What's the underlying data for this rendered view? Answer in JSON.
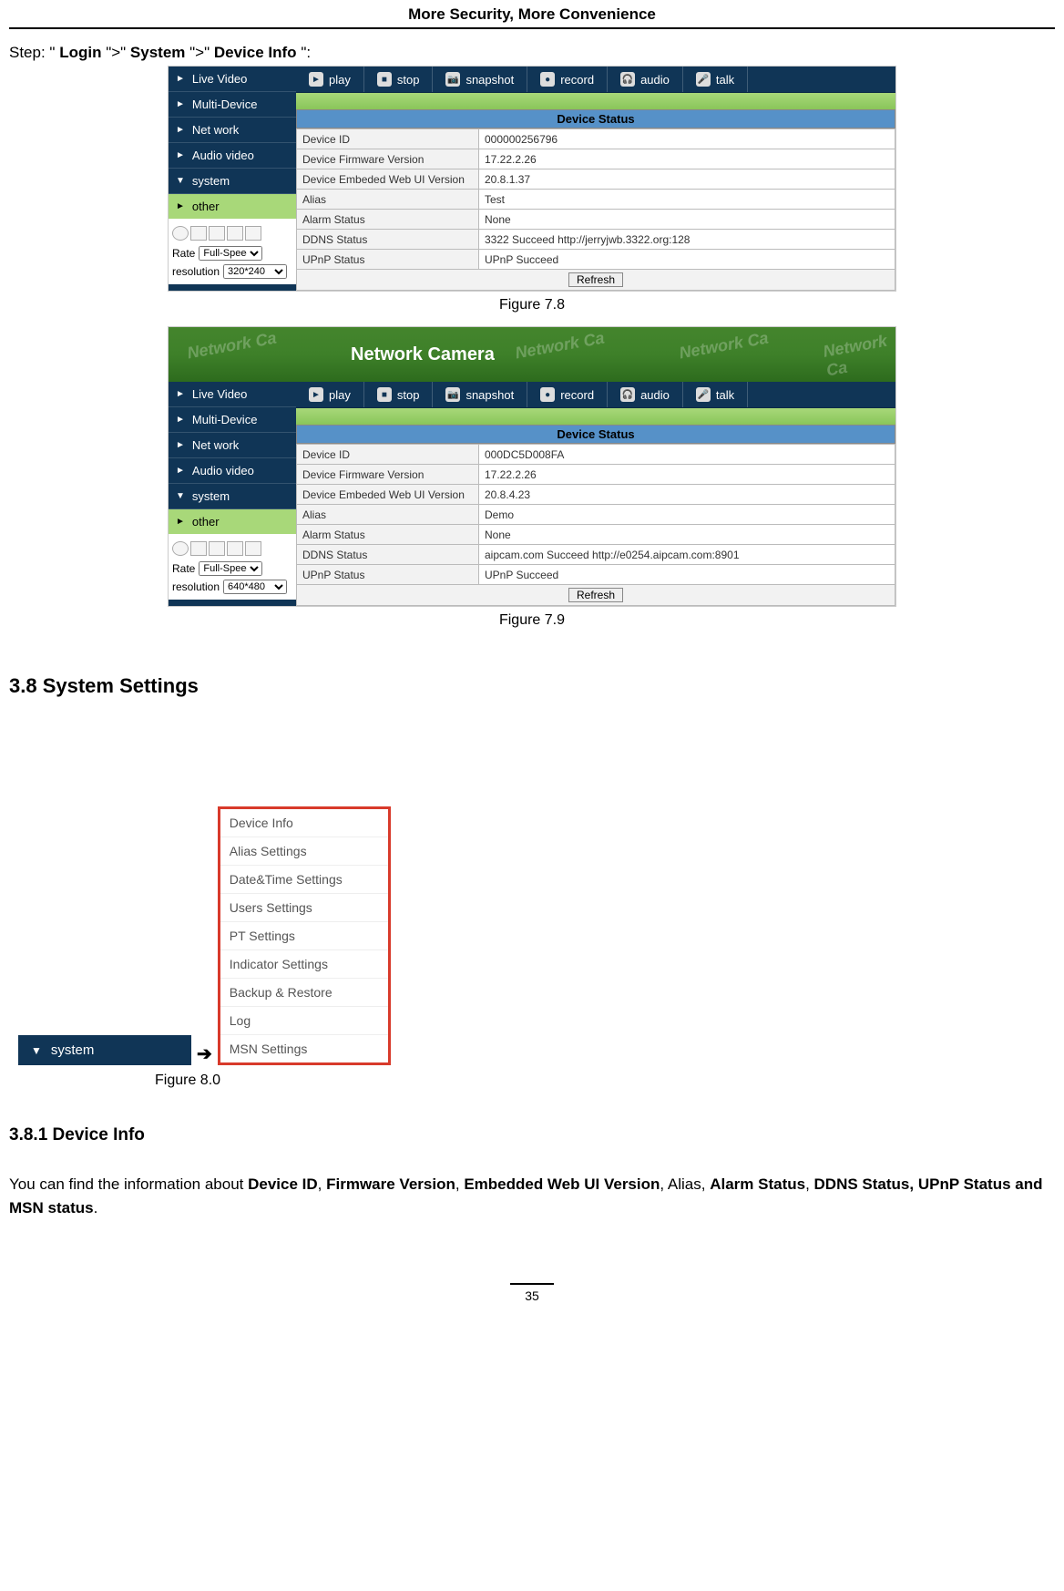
{
  "header_title": "More Security, More Convenience",
  "breadcrumb": {
    "prefix": "Step: \"",
    "p1": "Login",
    "s1": "\">\"",
    "p2": "System",
    "s2": "\">\"",
    "p3": "Device Info",
    "suffix": "\":"
  },
  "sidebar_items": [
    {
      "label": "Live Video",
      "arrow": "►",
      "open": false
    },
    {
      "label": "Multi-Device",
      "arrow": "►",
      "open": false
    },
    {
      "label": "Net work",
      "arrow": "►",
      "open": false
    },
    {
      "label": "Audio video",
      "arrow": "►",
      "open": false
    },
    {
      "label": "system",
      "arrow": "▼",
      "open": true
    },
    {
      "label": "other",
      "arrow": "►",
      "open": false
    }
  ],
  "toolbar_items": [
    {
      "label": "play",
      "icon": "►",
      "name": "play-button"
    },
    {
      "label": "stop",
      "icon": "■",
      "name": "stop-button"
    },
    {
      "label": "snapshot",
      "icon": "📷",
      "name": "snapshot-button"
    },
    {
      "label": "record",
      "icon": "●",
      "name": "record-button"
    },
    {
      "label": "audio",
      "icon": "🎧",
      "name": "audio-button"
    },
    {
      "label": "talk",
      "icon": "🎤",
      "name": "talk-button"
    }
  ],
  "status_header": "Device Status",
  "fig78": {
    "rows": [
      {
        "k": "Device ID",
        "v": "000000256796"
      },
      {
        "k": "Device Firmware Version",
        "v": "17.22.2.26"
      },
      {
        "k": "Device Embeded Web UI Version",
        "v": "20.8.1.37"
      },
      {
        "k": "Alias",
        "v": "Test"
      },
      {
        "k": "Alarm Status",
        "v": "None"
      },
      {
        "k": "DDNS Status",
        "v": "3322 Succeed  http://jerryjwb.3322.org:128"
      },
      {
        "k": "UPnP Status",
        "v": "UPnP Succeed"
      }
    ],
    "rate_label": "Rate",
    "rate_value": "Full-Speed",
    "res_label": "resolution",
    "res_value": "320*240",
    "caption": "Figure 7.8"
  },
  "fig79": {
    "banner_text": "Network Camera",
    "wm_text": "Network Ca",
    "rows": [
      {
        "k": "Device ID",
        "v": "000DC5D008FA"
      },
      {
        "k": "Device Firmware Version",
        "v": "17.22.2.26"
      },
      {
        "k": "Device Embeded Web UI Version",
        "v": "20.8.4.23"
      },
      {
        "k": "Alias",
        "v": "Demo"
      },
      {
        "k": "Alarm Status",
        "v": "None"
      },
      {
        "k": "DDNS Status",
        "v": "aipcam.com  Succeed  http://e0254.aipcam.com:8901"
      },
      {
        "k": "UPnP Status",
        "v": "UPnP Succeed"
      }
    ],
    "rate_label": "Rate",
    "rate_value": "Full-Speed",
    "res_label": "resolution",
    "res_value": "640*480",
    "caption": "Figure 7.9"
  },
  "refresh_label": "Refresh",
  "section_38_title": "3.8 System Settings",
  "fig80": {
    "system_btn": "system",
    "menu": [
      "Device Info",
      "Alias Settings",
      "Date&Time Settings",
      "Users Settings",
      "PT Settings",
      "Indicator Settings",
      "Backup & Restore",
      "Log",
      "MSN Settings"
    ],
    "caption": "Figure 8.0",
    "arrow": "➔"
  },
  "subsection_381_title": "3.8.1 Device Info",
  "para": {
    "pre": "You can find the information about ",
    "b1": "Device ID",
    "c1": ", ",
    "b2": "Firmware Version",
    "c2": ", ",
    "b3": "Embedded Web UI Version",
    "c3": ", Alias, ",
    "b4": "Alarm Status",
    "c4": ", ",
    "b5": "DDNS Status, UPnP Status and MSN status",
    "end": "."
  },
  "page_number": "35"
}
